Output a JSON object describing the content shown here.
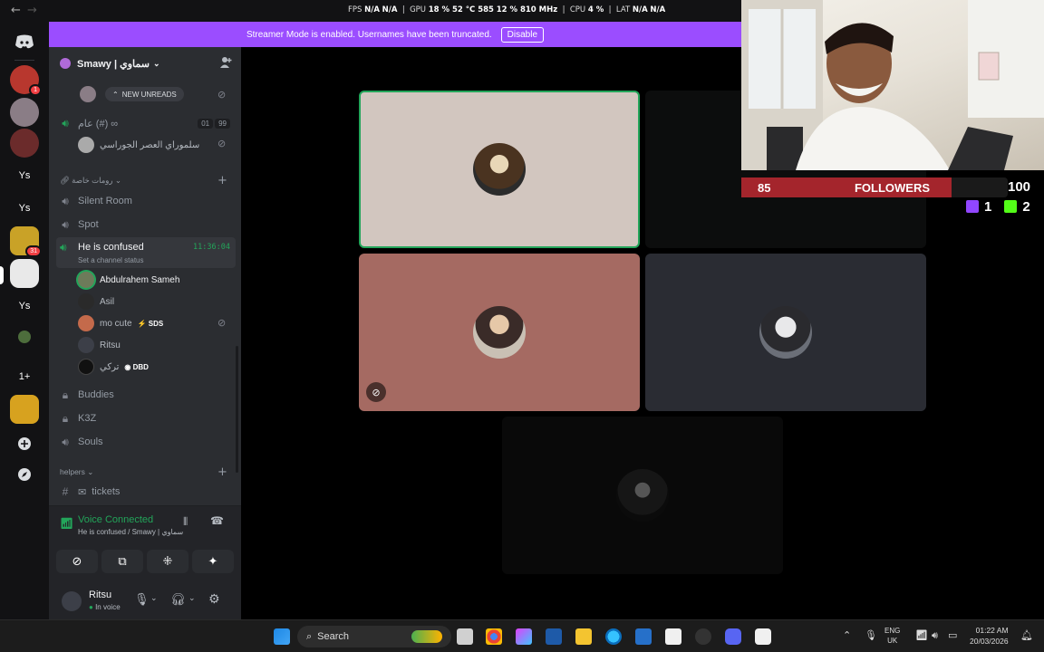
{
  "top_bar": {
    "back_glyph": "←",
    "forward_glyph": "→",
    "stats": {
      "fps_label": "FPS",
      "fps_value": "N/A",
      "fps_value2": "N/A",
      "gpu_label": "GPU",
      "gpu_value": "18 % 52 °C 585",
      "gpu_clock": "12 % 810 MHz",
      "cpu_label": "CPU",
      "cpu_value": "4 %",
      "lat_label": "LAT",
      "lat_value": "N/A",
      "lat_value2": "N/A"
    },
    "window_title": "Smawy | سماوي"
  },
  "banner": {
    "text": "Streamer Mode is enabled. Usernames have been truncated.",
    "button": "Disable"
  },
  "rail": {
    "items": [
      {
        "icon": "discord-icon"
      },
      {
        "label": "",
        "badge": "1",
        "color": "#b8372e"
      },
      {
        "label": "",
        "color": "#8a7d86"
      },
      {
        "label": "",
        "color": "#6b2b2b"
      },
      {
        "label": "Ys",
        "color": "#121214"
      },
      {
        "label": "Ys",
        "color": "#121214"
      },
      {
        "label": "",
        "badge": "31",
        "color": "#c9a227"
      },
      {
        "label": "",
        "color": "#e9e9e9"
      },
      {
        "label": "Ys",
        "color": "#121214"
      },
      {
        "label": "",
        "color": "#4d6d3c"
      },
      {
        "label": "1+",
        "color": "#121214"
      },
      {
        "label": "",
        "color": "#d7a21f"
      }
    ]
  },
  "sidebar": {
    "guild_name": "Smawy | سماوي",
    "new_unreads": "NEW UNREADS",
    "top_channel": "عام (#) ∞",
    "top_counts": [
      "01",
      "99"
    ],
    "top_user": "سلموراي العصر الجوراسي",
    "category_private": "رومات خاصة",
    "channels": [
      "Silent Room",
      "Spot"
    ],
    "active_channel": {
      "name": "He is confused",
      "timer": "11:36:04",
      "status": "Set a channel status"
    },
    "members": [
      {
        "name": "Abdulrahem Sameh",
        "tag": "",
        "color": "#6d7b5a"
      },
      {
        "name": "Asil",
        "tag": "",
        "color": "#2a2a2a"
      },
      {
        "name": "mo cute",
        "tag": "SDS",
        "color": "#c46a4b"
      },
      {
        "name": "Ritsu",
        "tag": "",
        "color": "#3c3f48"
      },
      {
        "name": "تركي",
        "tag": "DBD",
        "color": "#111"
      }
    ],
    "locked_channels": [
      "Buddies",
      "K3Z"
    ],
    "channel_souls": "Souls",
    "category_helpers": "helpers",
    "text_channel": "tickets"
  },
  "voice_panel": {
    "title": "Voice Connected",
    "subtitle": "He is confused / Smawy | سماوي",
    "user_name": "Ritsu",
    "user_status": "In voice"
  },
  "stream_overlay": {
    "followers_count": "85",
    "followers_label": "FOLLOWERS",
    "goal": "100",
    "twitch_count": "1",
    "kick_count": "2"
  },
  "taskbar": {
    "search_placeholder": "Search",
    "lang_top": "ENG",
    "lang_bottom": "UK",
    "time": "01:22 AM",
    "date": "20/03/2026"
  },
  "colors": {
    "accent": "#9b4dff",
    "voice_green": "#23a55a",
    "followers_red": "#a4252c"
  }
}
